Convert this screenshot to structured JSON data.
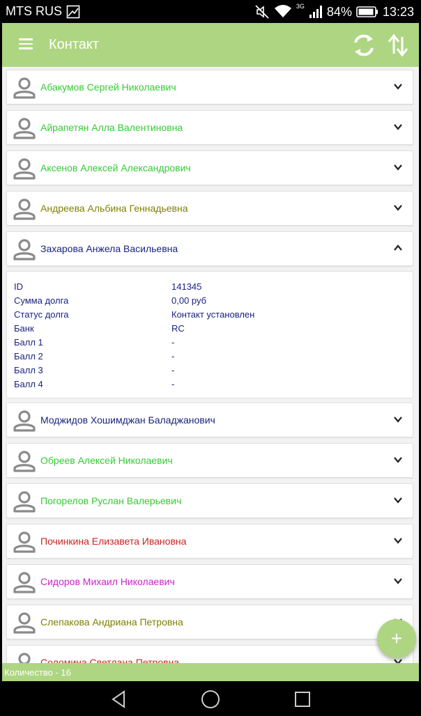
{
  "status_bar": {
    "carrier": "MTS RUS",
    "network": "3G",
    "battery": "84%",
    "time": "13:23"
  },
  "app_bar": {
    "title": "Контакт",
    "menu_icon": "hamburger-menu-icon",
    "sync_icon": "sync-icon",
    "sort_icon": "sort-icon"
  },
  "contacts": [
    {
      "name": "Абакумов Сергей Николаевич",
      "color": "#33cc33",
      "expanded": false
    },
    {
      "name": "Айрапетян Алла Валентиновна",
      "color": "#33cc33",
      "expanded": false
    },
    {
      "name": "Аксенов Алексей Александрович",
      "color": "#33cc33",
      "expanded": false
    },
    {
      "name": "Андреева Альбина Геннадьевна",
      "color": "#808000",
      "expanded": false
    },
    {
      "name": "Захарова Анжела Васильевна",
      "color": "#1a237e",
      "expanded": true
    },
    {
      "name": "Моджидов Хошимджан Баладжанович",
      "color": "#1a237e",
      "expanded": false
    },
    {
      "name": "Обреев Алексей Николаевич",
      "color": "#33cc33",
      "expanded": false
    },
    {
      "name": "Погорелов Руслан Валерьевич",
      "color": "#33cc33",
      "expanded": false
    },
    {
      "name": "Починкина Елизавета Ивановна",
      "color": "#cc2222",
      "expanded": false
    },
    {
      "name": "Сидоров Михаил Николаевич",
      "color": "#cc22cc",
      "expanded": false
    },
    {
      "name": "Слепакова Андриана Петровна",
      "color": "#808000",
      "expanded": false
    },
    {
      "name": "Соломина Светлана Петровна",
      "color": "#cc2222",
      "expanded": false
    }
  ],
  "details": [
    {
      "key": "ID",
      "value": "141345"
    },
    {
      "key": "Сумма долга",
      "value": "0,00 руб"
    },
    {
      "key": "Статус долга",
      "value": "Контакт установлен"
    },
    {
      "key": "Банк",
      "value": "RC"
    },
    {
      "key": "Балл 1",
      "value": "-"
    },
    {
      "key": "Балл 2",
      "value": "-"
    },
    {
      "key": "Балл 3",
      "value": "-"
    },
    {
      "key": "Балл 4",
      "value": "-"
    }
  ],
  "footer": {
    "count_label": "Количество - 16"
  },
  "fab": {
    "label": "+"
  },
  "colors": {
    "accent": "#aed581",
    "text_dark": "#1a237e"
  }
}
